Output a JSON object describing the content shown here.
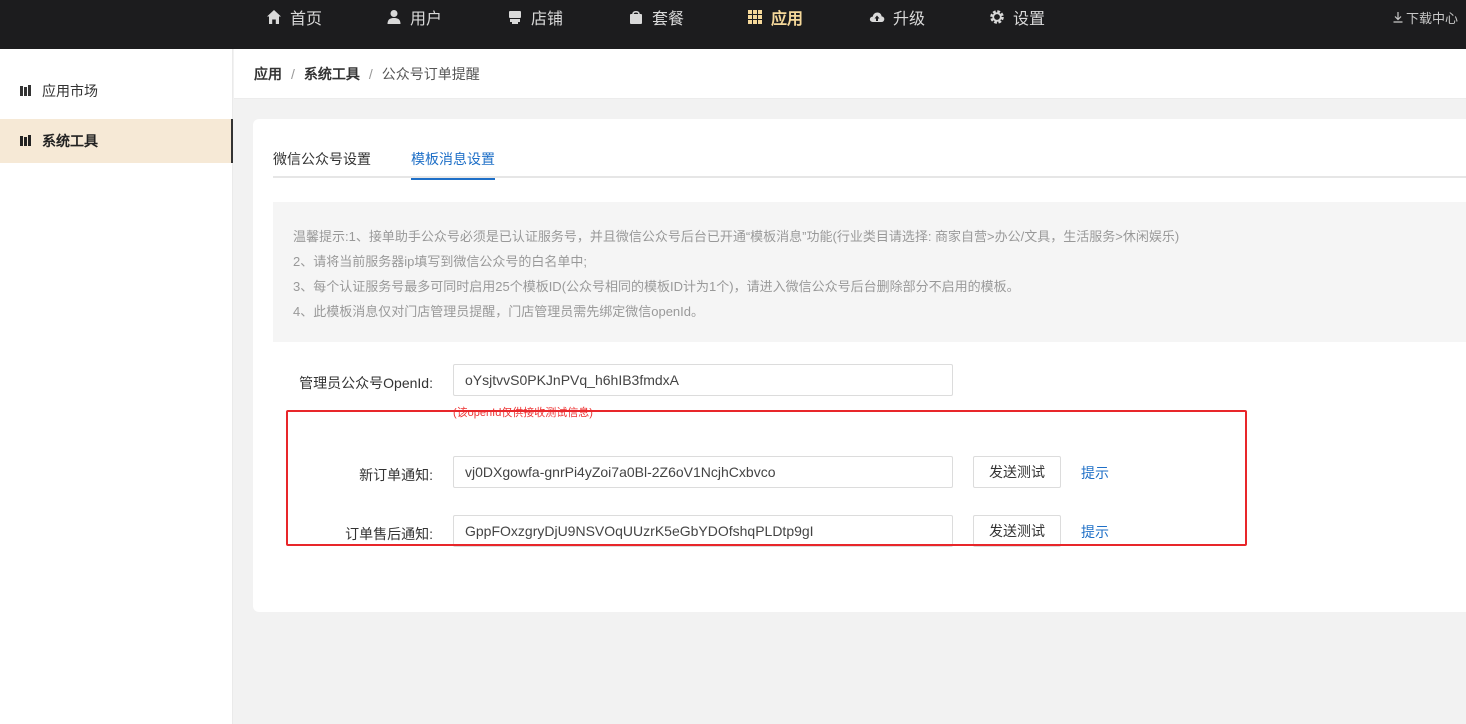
{
  "topnav": {
    "items": [
      {
        "label": "首页",
        "icon": "home-icon"
      },
      {
        "label": "用户",
        "icon": "user-icon"
      },
      {
        "label": "店铺",
        "icon": "store-icon"
      },
      {
        "label": "套餐",
        "icon": "package-icon"
      },
      {
        "label": "应用",
        "icon": "apps-grid-icon",
        "active": true
      },
      {
        "label": "升级",
        "icon": "cloud-upload-icon"
      },
      {
        "label": "设置",
        "icon": "gear-icon"
      }
    ],
    "download": "下载中心",
    "active_color": "#f5d89a"
  },
  "sidebar": {
    "items": [
      {
        "label": "应用市场",
        "icon": "book-icon"
      },
      {
        "label": "系统工具",
        "icon": "book-icon",
        "active": true
      }
    ]
  },
  "breadcrumb": {
    "items": [
      "应用",
      "系统工具",
      "公众号订单提醒"
    ],
    "separator": "/"
  },
  "tabs": [
    {
      "label": "微信公众号设置"
    },
    {
      "label": "模板消息设置",
      "active": true
    }
  ],
  "notice": {
    "lines": [
      "温馨提示:1、接单助手公众号必须是已认证服务号，并且微信公众号后台已开通“模板消息”功能(行业类目请选择: 商家自营>办公/文具，生活服务>休闲娱乐)",
      "2、请将当前服务器ip填写到微信公众号的白名单中;",
      "3、每个认证服务号最多可同时启用25个模板ID(公众号相同的模板ID计为1个)，请进入微信公众号后台删除部分不启用的模板。",
      "4、此模板消息仅对门店管理员提醒，门店管理员需先绑定微信openId。"
    ]
  },
  "form": {
    "openid": {
      "label": "管理员公众号OpenId:",
      "value": "oYsjtvvS0PKJnPVq_h6hIB3fmdxA",
      "hint": "(该openId仅供接收测试信息)"
    },
    "new_order": {
      "label": "新订单通知:",
      "value": "vj0DXgowfa-gnrPi4yZoi7a0Bl-2Z6oV1NcjhCxbvco",
      "button": "发送测试",
      "tip": "提示"
    },
    "after_sale": {
      "label": "订单售后通知:",
      "value": "GppFOxzgryDjU9NSVOqUUzrK5eGbYDOfshqPLDtp9gI",
      "button": "发送测试",
      "tip": "提示"
    }
  },
  "colors": {
    "accent_blue": "#1e6fc7",
    "highlight_red": "#e8262a",
    "sidebar_active_bg": "#f6e9d6"
  }
}
